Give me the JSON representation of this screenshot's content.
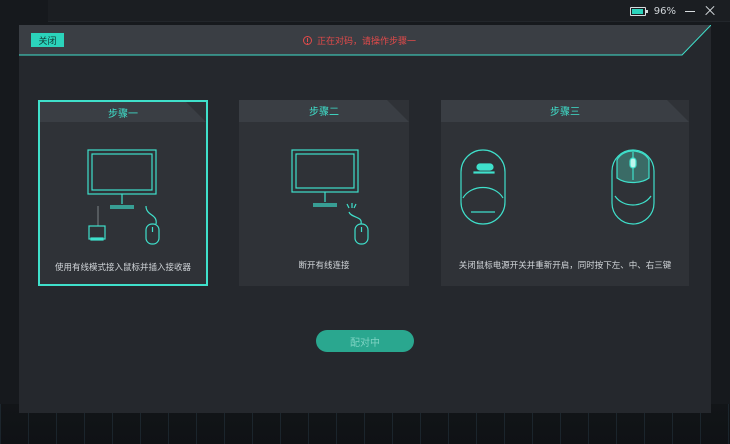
{
  "system": {
    "battery_percent": "96%",
    "battery_level": 0.96
  },
  "dialog": {
    "close_label": "关闭",
    "status_text": "正在对码，请操作步骤一",
    "steps": [
      {
        "title": "步骤一",
        "description": "使用有线模式接入鼠标并插入接收器",
        "active": true
      },
      {
        "title": "步骤二",
        "description": "断开有线连接",
        "active": false
      },
      {
        "title": "步骤三",
        "description": "关闭鼠标电源开关并重新开启，同时按下左、中、右三键",
        "active": false
      }
    ],
    "pair_button_label": "配对中"
  },
  "colors": {
    "accent": "#3fe0cb",
    "button": "#2aa78f",
    "error": "#e24a4a",
    "panel": "#25282d",
    "card": "#2f3237"
  }
}
